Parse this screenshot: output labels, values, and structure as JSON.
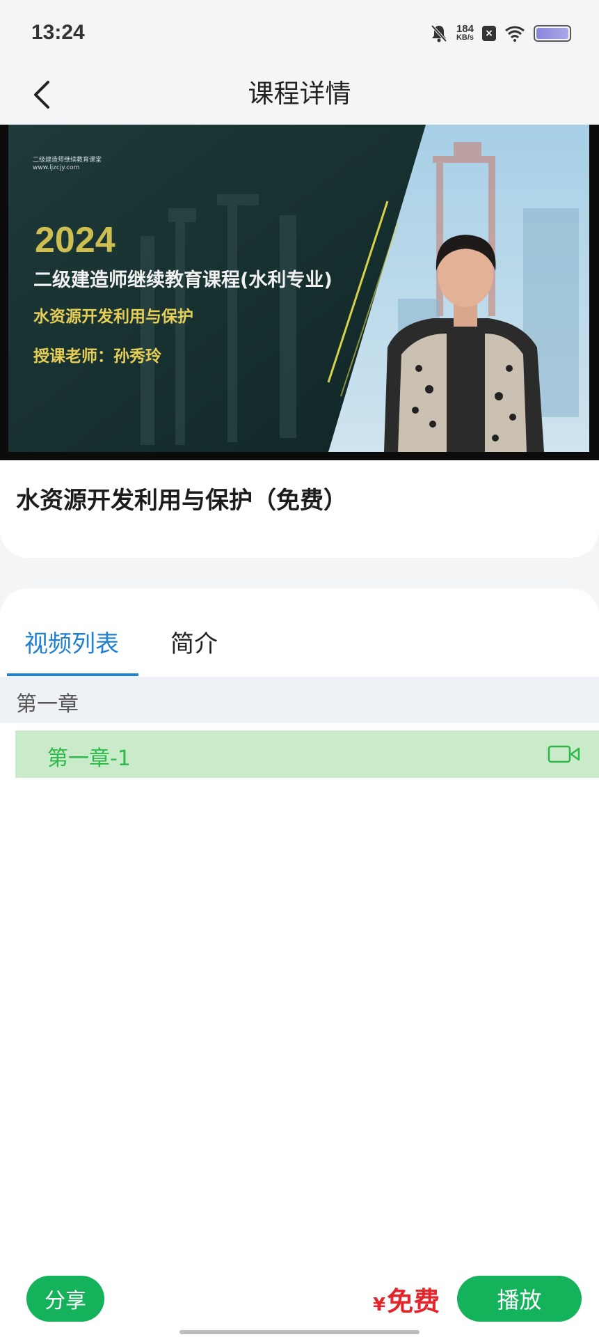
{
  "status_bar": {
    "time": "13:24",
    "net_speed_value": "184",
    "net_speed_unit": "KB/s",
    "icons": [
      "mute-bell-icon",
      "notification-x-icon",
      "wifi-icon",
      "battery-icon"
    ]
  },
  "nav": {
    "title": "课程详情",
    "back_icon": "chevron-left-icon"
  },
  "video": {
    "watermark_line1": "二级建造师继续教育课堂",
    "watermark_line2": "www.ljzcjy.com",
    "year": "2024",
    "course_series": "二级建造师继续教育课程(水利专业)",
    "subject": "水资源开发利用与保护",
    "teacher": "授课老师：孙秀玲"
  },
  "course": {
    "title": "水资源开发利用与保护（免费）"
  },
  "tabs": [
    {
      "label": "视频列表",
      "active": true
    },
    {
      "label": "简介",
      "active": false
    }
  ],
  "chapters": [
    {
      "title": "第一章",
      "lessons": [
        {
          "label": "第一章-1",
          "icon": "video-camera-icon",
          "selected": true
        }
      ]
    }
  ],
  "bottom": {
    "share_label": "分享",
    "price_currency": "¥",
    "price_value": "免费",
    "play_label": "播放"
  },
  "colors": {
    "accent_blue": "#1f7fd0",
    "primary_green": "#14b35b",
    "lesson_highlight": "#caebca",
    "lesson_text": "#2eb84a",
    "price_red": "#e3262c"
  }
}
